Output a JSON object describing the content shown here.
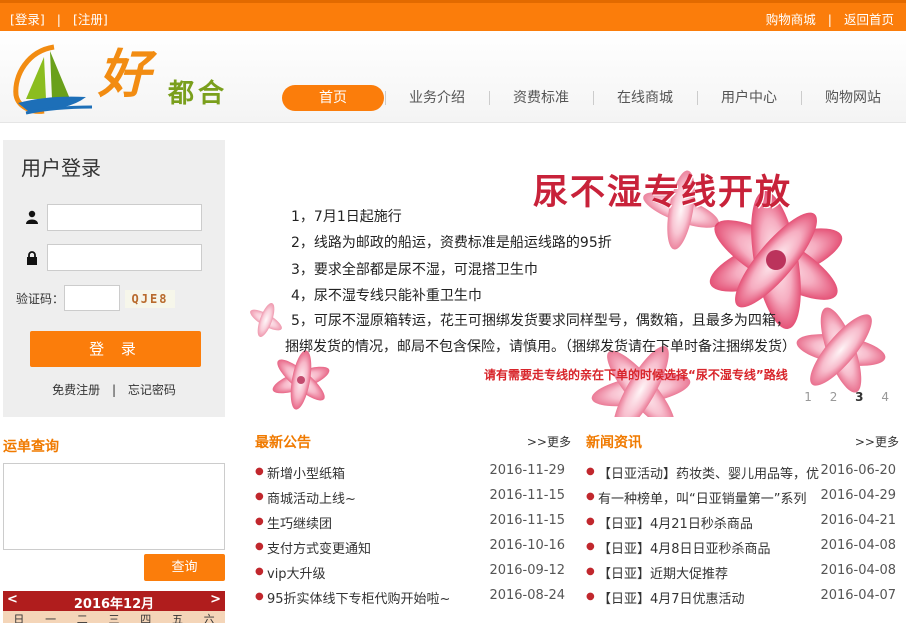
{
  "topbar": {
    "login": "[登录]",
    "separator": "|",
    "register": "[注册]",
    "shop": "购物商城",
    "home_back": "返回首页"
  },
  "logo": {
    "char1": "好",
    "chars": "都合"
  },
  "nav": [
    "首页",
    "业务介绍",
    "资费标准",
    "在线商城",
    "用户中心",
    "购物网站"
  ],
  "login": {
    "title": "用户登录",
    "captcha_label": "验证码：",
    "captcha_text": "QJE8",
    "button": "登 录",
    "register_link": "免费注册",
    "forgot_link": "忘记密码",
    "sep": "|"
  },
  "banner": {
    "headline": "尿不湿专线开放",
    "lines": [
      "1，7月1日起施行",
      "2，线路为邮政的船运，资费标准是船运线路的95折",
      "3，要求全部都是尿不湿，可混搭卫生巾",
      "4，尿不湿专线只能补重卫生巾",
      "5，可尿不湿原箱转运，花王可捆绑发货要求同样型号，偶数箱，且最多为四箱，",
      "捆绑发货的情况，邮局不包含保险，请慎用。（捆绑发货请在下单时备注捆绑发货）"
    ],
    "note": "请有需要走专线的亲在下单的时候选择“尿不湿专线”路线",
    "pages": [
      "1",
      "2",
      "3",
      "4"
    ],
    "active_page": "3"
  },
  "tracking": {
    "title": "运单查询",
    "button": "查询"
  },
  "calendar": {
    "prev": "<",
    "month": "2016年12月",
    "next": ">",
    "weekdays": [
      "日",
      "一",
      "二",
      "三",
      "四",
      "五",
      "六"
    ]
  },
  "notices": {
    "title": "最新公告",
    "more": ">>更多",
    "items": [
      {
        "text": "新增小型纸箱",
        "date": "2016-11-29"
      },
      {
        "text": "商城活动上线~",
        "date": "2016-11-15"
      },
      {
        "text": "生巧继续团",
        "date": "2016-11-15"
      },
      {
        "text": "支付方式变更通知",
        "date": "2016-10-16"
      },
      {
        "text": "vip大升级",
        "date": "2016-09-12"
      },
      {
        "text": "95折实体线下专柜代购开始啦~",
        "date": "2016-08-24"
      }
    ]
  },
  "news": {
    "title": "新闻资讯",
    "more": ">>更多",
    "items": [
      {
        "text": "【日亚活动】药妆类、婴儿用品等，优",
        "date": "2016-06-20"
      },
      {
        "text": "有一种榜单，叫“日亚销量第一”系列",
        "date": "2016-04-29"
      },
      {
        "text": "【日亚】4月21日秒杀商品",
        "date": "2016-04-21"
      },
      {
        "text": "【日亚】4月8日日亚秒杀商品",
        "date": "2016-04-08"
      },
      {
        "text": "【日亚】近期大促推荐",
        "date": "2016-04-08"
      },
      {
        "text": "【日亚】4月7日优惠活动",
        "date": "2016-04-07"
      }
    ]
  },
  "colors": {
    "accent": "#fb7d0b",
    "title_red": "#c8223a",
    "calendar_red": "#b01d1d"
  }
}
